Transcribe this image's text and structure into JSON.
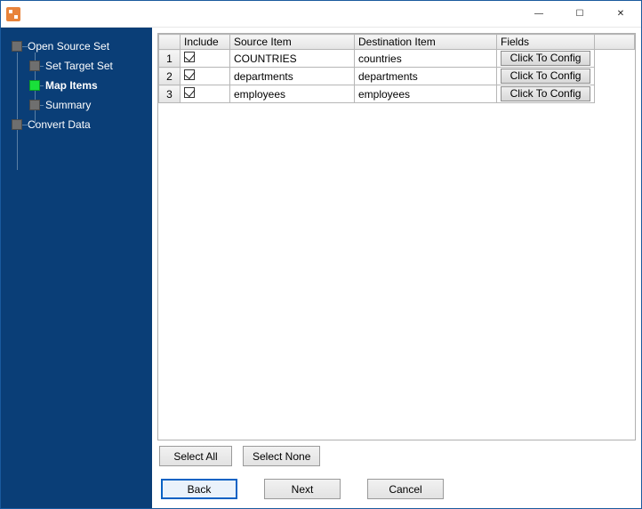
{
  "window": {
    "minimize_glyph": "—",
    "maximize_glyph": "☐",
    "close_glyph": "✕"
  },
  "sidebar": {
    "items": [
      {
        "label": "Open Source Set",
        "active": false
      },
      {
        "label": "Set Target Set",
        "active": false
      },
      {
        "label": "Map Items",
        "active": true
      },
      {
        "label": "Summary",
        "active": false
      },
      {
        "label": "Convert Data",
        "active": false
      }
    ]
  },
  "grid": {
    "headers": {
      "row": "",
      "include": "Include",
      "source": "Source Item",
      "destination": "Destination Item",
      "fields": "Fields"
    },
    "config_button_label": "Click To Config",
    "rows": [
      {
        "n": "1",
        "include": true,
        "source": "COUNTRIES",
        "destination": "countries"
      },
      {
        "n": "2",
        "include": true,
        "source": "departments",
        "destination": "departments"
      },
      {
        "n": "3",
        "include": true,
        "source": "employees",
        "destination": "employees"
      }
    ]
  },
  "buttons": {
    "select_all": "Select All",
    "select_none": "Select None",
    "back": "Back",
    "next": "Next",
    "cancel": "Cancel"
  }
}
